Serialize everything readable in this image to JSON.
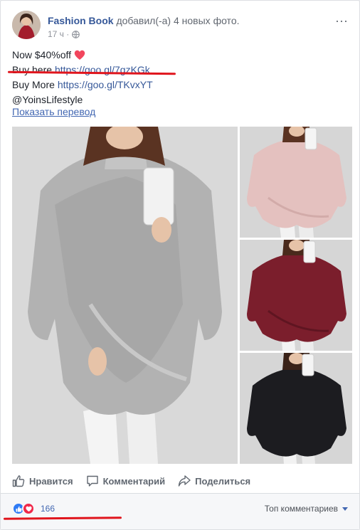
{
  "post": {
    "author": "Fashion Book",
    "action_text": "добавил(-а) 4 новых фото.",
    "time": "17 ч ·",
    "globe_icon": "globe-icon",
    "menu_icon": "more-horizontal-icon",
    "lines": {
      "line1": "Now $40%off",
      "line2_prefix": "Buy here ",
      "line2_link": "https://goo.gl/7gzKGk",
      "line3_prefix": "Buy More ",
      "line3_link": "https://goo.gl/TKvxYT",
      "line4": "@YoinsLifestyle"
    },
    "translate": "Показать перевод"
  },
  "photos": [
    {
      "name": "grey-poncho",
      "color": "#b8b8b8"
    },
    {
      "name": "pink-poncho",
      "color": "#e8c6c3"
    },
    {
      "name": "burgundy-poncho",
      "color": "#7a1f2c"
    },
    {
      "name": "black-poncho",
      "color": "#1e1e22"
    }
  ],
  "actions": {
    "like": "Нравится",
    "comment": "Комментарий",
    "share": "Поделиться"
  },
  "footer": {
    "reaction_count": "166",
    "top_comments": "Топ комментариев"
  },
  "colors": {
    "link": "#365899",
    "annotation_red": "#e0151d"
  }
}
